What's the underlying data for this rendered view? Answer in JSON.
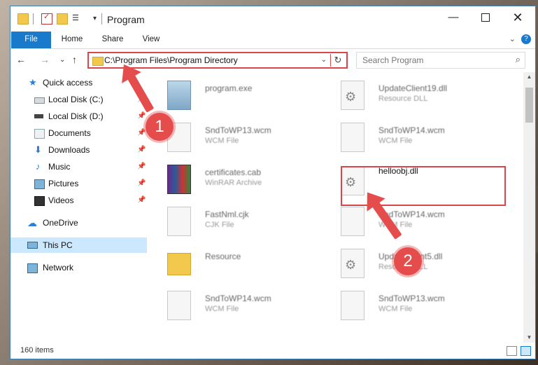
{
  "window": {
    "title": "Program",
    "minimize_glyph": "—",
    "close_glyph": "✕"
  },
  "quick_access_toolbar": {
    "dropdown_glyph": "▾"
  },
  "ribbon": {
    "tabs": [
      "File",
      "Home",
      "Share",
      "View"
    ],
    "expand_glyph": "⌄",
    "help_glyph": "?"
  },
  "navigation": {
    "back_glyph": "←",
    "forward_glyph": "→",
    "recent_glyph": "⌄",
    "up_glyph": "↑"
  },
  "address_bar": {
    "path": "C:\\Program Files\\Program Directory",
    "dropdown_glyph": "⌄",
    "refresh_glyph": "↻"
  },
  "search": {
    "placeholder": "Search Program",
    "icon": "⌕"
  },
  "nav_pane": {
    "items": [
      {
        "label": "Quick access",
        "icon": "star-icon",
        "pinned": false,
        "glyph": "★"
      },
      {
        "label": "Local Disk (C:)",
        "icon": "drive-icon",
        "pinned": true
      },
      {
        "label": "Local Disk (D:)",
        "icon": "drive-icon",
        "pinned": true
      },
      {
        "label": "Documents",
        "icon": "documents-icon",
        "pinned": true
      },
      {
        "label": "Downloads",
        "icon": "download-icon",
        "pinned": true,
        "glyph": "⬇"
      },
      {
        "label": "Music",
        "icon": "music-icon",
        "pinned": true,
        "glyph": "♪"
      },
      {
        "label": "Pictures",
        "icon": "pictures-icon",
        "pinned": true
      },
      {
        "label": "Videos",
        "icon": "videos-icon",
        "pinned": true
      },
      {
        "label": "OneDrive",
        "icon": "cloud-icon",
        "pinned": false,
        "glyph": "☁"
      },
      {
        "label": "This PC",
        "icon": "computer-icon",
        "pinned": false,
        "selected": true
      },
      {
        "label": "Network",
        "icon": "network-icon",
        "pinned": false
      }
    ],
    "pin_glyph": "📌"
  },
  "files": [
    {
      "name": "program.exe",
      "type": "",
      "icon": "exe-icon"
    },
    {
      "name": "UpdateClient19.dll",
      "type": "Resource DLL",
      "icon": "dll-icon"
    },
    {
      "name": "SndToWP13.wcm",
      "type": "WCM File",
      "icon": "file-icon"
    },
    {
      "name": "SndToWP14.wcm",
      "type": "WCM File",
      "icon": "file-icon"
    },
    {
      "name": "certificates.cab",
      "type": "WinRAR Archive",
      "icon": "archive-icon"
    },
    {
      "name": "helloobj.dll",
      "type": "",
      "icon": "dll-icon",
      "highlighted": true
    },
    {
      "name": "FastNml.cjk",
      "type": "CJK File",
      "icon": "file-icon"
    },
    {
      "name": "SndToWP14.wcm",
      "type": "WCM File",
      "icon": "file-icon"
    },
    {
      "name": "Resource",
      "type": "",
      "icon": "folder-icon"
    },
    {
      "name": "UpdateClient5.dll",
      "type": "Resource DLL",
      "icon": "dll-icon"
    },
    {
      "name": "SndToWP14.wcm",
      "type": "WCM File",
      "icon": "file-icon"
    },
    {
      "name": "SndToWP13.wcm",
      "type": "WCM File",
      "icon": "file-icon"
    }
  ],
  "scrollbar": {
    "up_glyph": "▲",
    "down_glyph": "▼"
  },
  "status_bar": {
    "item_count": "160 items"
  },
  "annotations": {
    "step1": "1",
    "step2": "2"
  },
  "colors": {
    "accent": "#1979ca",
    "highlight": "#d9464a",
    "selection": "#cce8ff"
  }
}
